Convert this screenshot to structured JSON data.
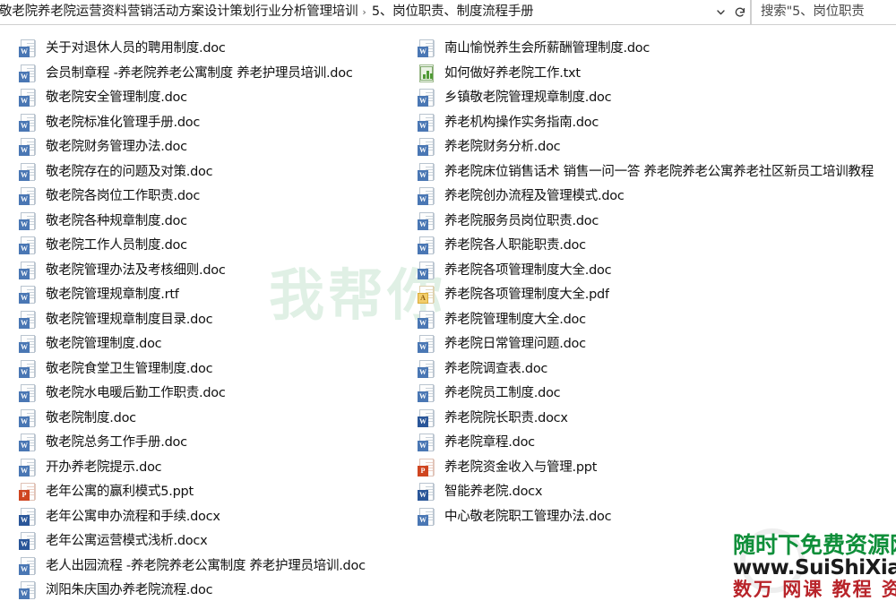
{
  "window": {
    "type": "file-explorer"
  },
  "address_bar": {
    "breadcrumbs": [
      "敬老院养老院运营资料营销活动方案设计策划行业分析管理培训",
      "5、岗位职责、制度流程手册"
    ],
    "separator": "›",
    "dropdown_icon": "chevron-down-icon",
    "refresh_icon": "refresh-icon"
  },
  "search": {
    "placeholder": "搜索\"5、岗位职责",
    "icon": "search-icon"
  },
  "files_left": [
    {
      "name": "关于对退休人员的聘用制度.doc",
      "type": "doc"
    },
    {
      "name": "会员制章程 -养老院养老公寓制度 养老护理员培训.doc",
      "type": "doc"
    },
    {
      "name": "敬老院安全管理制度.doc",
      "type": "doc"
    },
    {
      "name": "敬老院标准化管理手册.doc",
      "type": "doc"
    },
    {
      "name": "敬老院财务管理办法.doc",
      "type": "doc"
    },
    {
      "name": "敬老院存在的问题及对策.doc",
      "type": "doc"
    },
    {
      "name": "敬老院各岗位工作职责.doc",
      "type": "doc"
    },
    {
      "name": "敬老院各种规章制度.doc",
      "type": "doc"
    },
    {
      "name": "敬老院工作人员制度.doc",
      "type": "doc"
    },
    {
      "name": "敬老院管理办法及考核细则.doc",
      "type": "doc"
    },
    {
      "name": "敬老院管理规章制度.rtf",
      "type": "doc"
    },
    {
      "name": "敬老院管理规章制度目录.doc",
      "type": "doc"
    },
    {
      "name": "敬老院管理制度.doc",
      "type": "doc"
    },
    {
      "name": "敬老院食堂卫生管理制度.doc",
      "type": "doc"
    },
    {
      "name": "敬老院水电暖后勤工作职责.doc",
      "type": "doc"
    },
    {
      "name": "敬老院制度.doc",
      "type": "doc"
    },
    {
      "name": "敬老院总务工作手册.doc",
      "type": "doc"
    },
    {
      "name": "开办养老院提示.doc",
      "type": "doc"
    },
    {
      "name": "老年公寓的赢利模式5.ppt",
      "type": "ppt"
    },
    {
      "name": "老年公寓申办流程和手续.docx",
      "type": "docx"
    },
    {
      "name": "老年公寓运营模式浅析.docx",
      "type": "docx"
    },
    {
      "name": "老人出园流程 -养老院养老公寓制度 养老护理员培训.doc",
      "type": "doc"
    },
    {
      "name": "浏阳朱庆国办养老院流程.doc",
      "type": "doc"
    }
  ],
  "files_right": [
    {
      "name": "南山愉悦养生会所薪酬管理制度.doc",
      "type": "doc"
    },
    {
      "name": "如何做好养老院工作.txt",
      "type": "txt"
    },
    {
      "name": "乡镇敬老院管理规章制度.doc",
      "type": "doc"
    },
    {
      "name": "养老机构操作实务指南.doc",
      "type": "doc"
    },
    {
      "name": "养老院财务分析.doc",
      "type": "doc"
    },
    {
      "name": "养老院床位销售话术 销售一问一答 养老院养老公寓养老社区新员工培训教程",
      "type": "doc"
    },
    {
      "name": "养老院创办流程及管理模式.doc",
      "type": "doc"
    },
    {
      "name": "养老院服务员岗位职责.doc",
      "type": "doc"
    },
    {
      "name": "养老院各人职能职责.doc",
      "type": "doc"
    },
    {
      "name": "养老院各项管理制度大全.doc",
      "type": "doc"
    },
    {
      "name": "养老院各项管理制度大全.pdf",
      "type": "pdf"
    },
    {
      "name": "养老院管理制度大全.doc",
      "type": "doc"
    },
    {
      "name": "养老院日常管理问题.doc",
      "type": "doc"
    },
    {
      "name": "养老院调查表.doc",
      "type": "doc"
    },
    {
      "name": "养老院员工制度.doc",
      "type": "doc"
    },
    {
      "name": "养老院院长职责.docx",
      "type": "docx"
    },
    {
      "name": "养老院章程.doc",
      "type": "doc"
    },
    {
      "name": "养老院资金收入与管理.ppt",
      "type": "ppt"
    },
    {
      "name": "智能养老院.docx",
      "type": "docx"
    },
    {
      "name": "中心敬老院职工管理办法.doc",
      "type": "doc"
    }
  ],
  "watermarks": {
    "center_text": "我帮你",
    "center_color": "#2f9e4f",
    "logo_line1": "随时下免费资源网",
    "logo_line2": "www.SuiShiXia.com",
    "logo_line3": "数万 网课 教程 资源",
    "logo_color1": "#0f8f3a",
    "logo_color2": "#1b1b1b",
    "logo_color3": "#b8242a"
  },
  "icon_badges": {
    "doc": "W",
    "docx": "W",
    "ppt": "P",
    "pdf": "A",
    "txt": ""
  }
}
